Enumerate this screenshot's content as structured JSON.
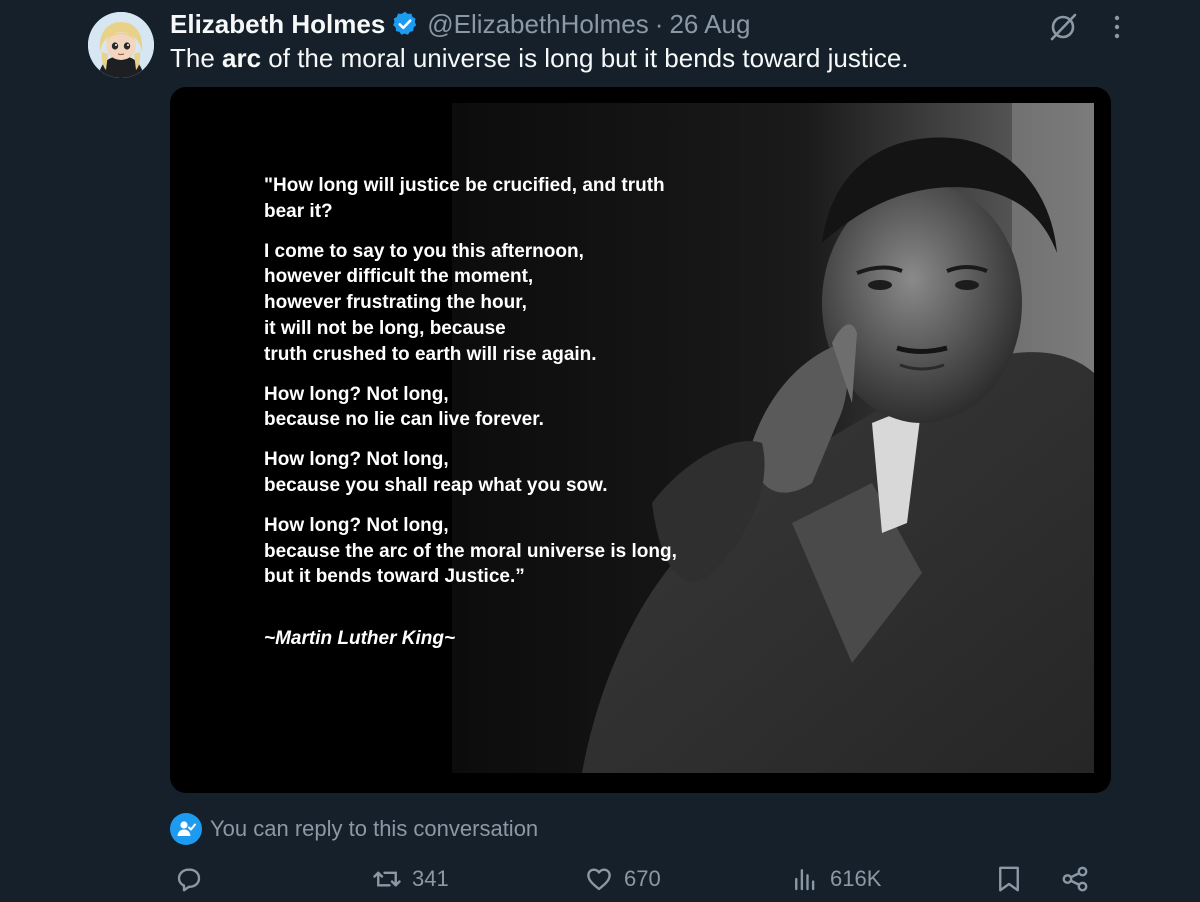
{
  "post": {
    "author_name": "Elizabeth Holmes",
    "handle": "@ElizabethHolmes",
    "separator": "·",
    "date": "26 Aug",
    "text_before": "The ",
    "text_bold": "arc",
    "text_after": " of the moral universe is long but it bends toward justice."
  },
  "media": {
    "quote_paragraphs": [
      [
        "\"How long will justice be crucified, and truth",
        "bear it?"
      ],
      [
        "I come to say to you this afternoon,",
        "however difficult the moment,",
        "however frustrating the hour,",
        "it will not be long, because",
        "truth crushed to earth will rise again."
      ],
      [
        "How long? Not long,",
        "because no lie can live forever."
      ],
      [
        "How long? Not long,",
        "because you shall reap what you sow."
      ],
      [
        "How long? Not long,",
        "because the arc of the moral universe is long,",
        "but it bends toward Justice.”"
      ]
    ],
    "signature": "~Martin Luther King~"
  },
  "reply_notice": "You can reply to this conversation",
  "actions": {
    "retweets": "341",
    "likes": "670",
    "views": "616K"
  },
  "icons": [
    "verified-badge-icon",
    "grok-icon",
    "more-icon",
    "reply-permission-icon",
    "reply-icon",
    "retweet-icon",
    "like-icon",
    "views-icon",
    "bookmark-icon",
    "share-icon"
  ],
  "colors": {
    "background": "#15202b",
    "text_primary": "#f7f9f9",
    "text_secondary": "#8b98a5",
    "accent": "#1d9bf0"
  }
}
